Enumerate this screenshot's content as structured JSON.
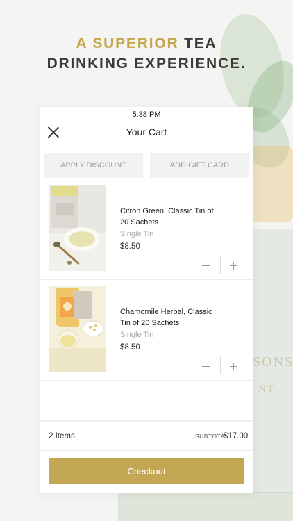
{
  "headline": {
    "accent": "A SUPERIOR",
    "rest_line1": " TEA",
    "line2": "DRINKING EXPERIENCE."
  },
  "status_bar": {
    "time": "5:38 PM"
  },
  "cart": {
    "title": "Your Cart",
    "apply_discount_label": "APPLY DISCOUNT",
    "add_gift_card_label": "ADD GIFT CARD",
    "items": [
      {
        "name": "Citron Green, Classic Tin of 20 Sachets",
        "variant": "Single Tin",
        "price": "$8.50"
      },
      {
        "name": "Chamomile Herbal, Classic Tin of 20 Sachets",
        "variant": "Single Tin",
        "price": "$8.50"
      }
    ],
    "items_count": "2 Items",
    "subtotal_label": "SUBTOTAL",
    "subtotal_value": "$17.00",
    "checkout_label": "Checkout"
  },
  "background": {
    "box_text_1": "SONS",
    "box_text_2": "NT"
  },
  "colors": {
    "accent": "#c5a64d",
    "checkout": "#c3a752"
  }
}
